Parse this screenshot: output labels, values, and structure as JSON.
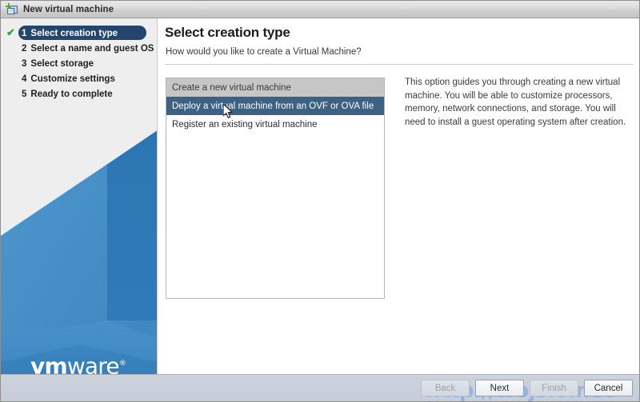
{
  "window": {
    "title": "New virtual machine",
    "icon": "new-virtual-machine-icon"
  },
  "sidebar": {
    "steps": [
      {
        "number": "1",
        "label": "Select creation type",
        "active": true,
        "completed": true
      },
      {
        "number": "2",
        "label": "Select a name and guest OS",
        "active": false,
        "completed": false
      },
      {
        "number": "3",
        "label": "Select storage",
        "active": false,
        "completed": false
      },
      {
        "number": "4",
        "label": "Customize settings",
        "active": false,
        "completed": false
      },
      {
        "number": "5",
        "label": "Ready to complete",
        "active": false,
        "completed": false
      }
    ],
    "check_glyph": "✔",
    "logo": {
      "part1": "vm",
      "part2": "ware",
      "tm": "®"
    }
  },
  "main": {
    "title": "Select creation type",
    "subtitle": "How would you like to create a Virtual Machine?",
    "options": [
      {
        "label": "Create a new virtual machine",
        "state": "header"
      },
      {
        "label": "Deploy a virtual machine from an OVF or OVA file",
        "state": "selected"
      },
      {
        "label": "Register an existing virtual machine",
        "state": "normal"
      }
    ],
    "description": "This option guides you through creating a new virtual machine. You will be able to customize processors, memory, network connections, and storage. You will need to install a guest operating system after creation."
  },
  "footer": {
    "watermark": "http://wojsle.net",
    "buttons": [
      {
        "label": "Back",
        "enabled": false
      },
      {
        "label": "Next",
        "enabled": true
      },
      {
        "label": "Finish",
        "enabled": false
      },
      {
        "label": "Cancel",
        "enabled": true
      }
    ]
  },
  "colors": {
    "accent_blue": "#24456e",
    "selection_blue": "#3d6183",
    "brand_blue": "#2f7ec0",
    "check_green": "#3e9e3e",
    "header_gray": "#c6c6c6",
    "footer_gray": "#ccd2dc"
  }
}
